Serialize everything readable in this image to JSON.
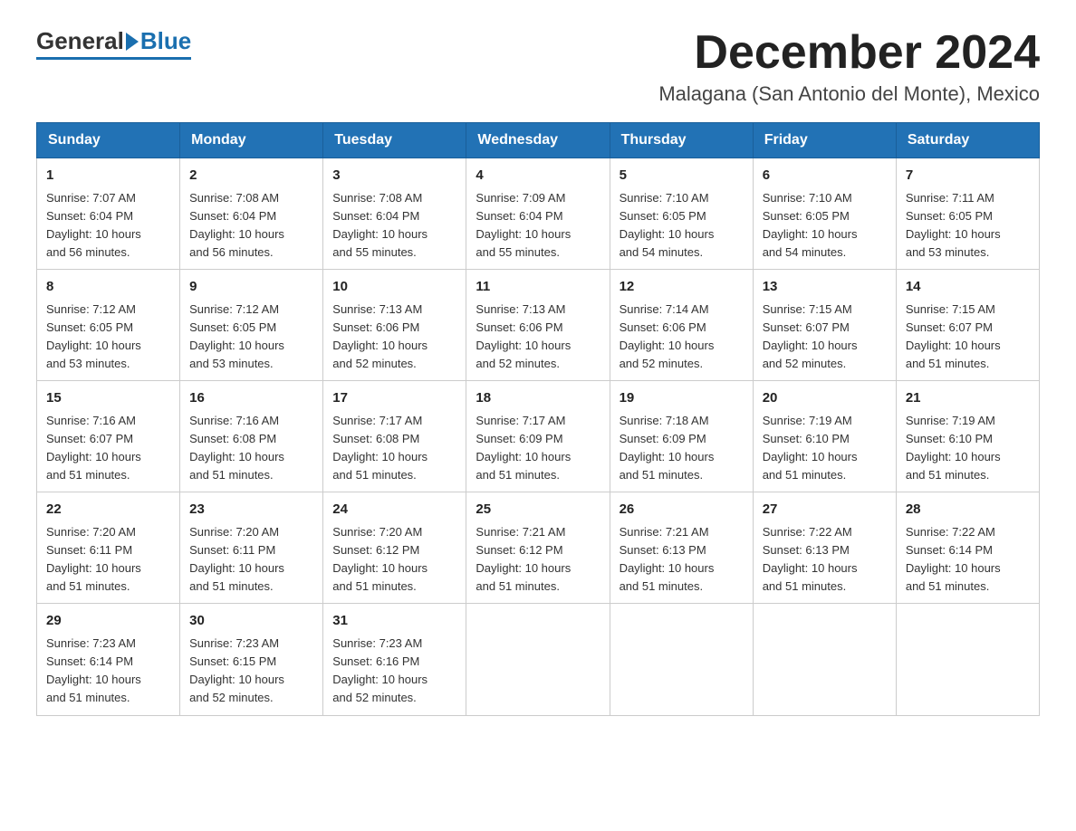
{
  "logo": {
    "general": "General",
    "blue": "Blue"
  },
  "title": "December 2024",
  "subtitle": "Malagana (San Antonio del Monte), Mexico",
  "weekdays": [
    "Sunday",
    "Monday",
    "Tuesday",
    "Wednesday",
    "Thursday",
    "Friday",
    "Saturday"
  ],
  "weeks": [
    [
      {
        "day": "1",
        "sunrise": "7:07 AM",
        "sunset": "6:04 PM",
        "daylight": "10 hours and 56 minutes."
      },
      {
        "day": "2",
        "sunrise": "7:08 AM",
        "sunset": "6:04 PM",
        "daylight": "10 hours and 56 minutes."
      },
      {
        "day": "3",
        "sunrise": "7:08 AM",
        "sunset": "6:04 PM",
        "daylight": "10 hours and 55 minutes."
      },
      {
        "day": "4",
        "sunrise": "7:09 AM",
        "sunset": "6:04 PM",
        "daylight": "10 hours and 55 minutes."
      },
      {
        "day": "5",
        "sunrise": "7:10 AM",
        "sunset": "6:05 PM",
        "daylight": "10 hours and 54 minutes."
      },
      {
        "day": "6",
        "sunrise": "7:10 AM",
        "sunset": "6:05 PM",
        "daylight": "10 hours and 54 minutes."
      },
      {
        "day": "7",
        "sunrise": "7:11 AM",
        "sunset": "6:05 PM",
        "daylight": "10 hours and 53 minutes."
      }
    ],
    [
      {
        "day": "8",
        "sunrise": "7:12 AM",
        "sunset": "6:05 PM",
        "daylight": "10 hours and 53 minutes."
      },
      {
        "day": "9",
        "sunrise": "7:12 AM",
        "sunset": "6:05 PM",
        "daylight": "10 hours and 53 minutes."
      },
      {
        "day": "10",
        "sunrise": "7:13 AM",
        "sunset": "6:06 PM",
        "daylight": "10 hours and 52 minutes."
      },
      {
        "day": "11",
        "sunrise": "7:13 AM",
        "sunset": "6:06 PM",
        "daylight": "10 hours and 52 minutes."
      },
      {
        "day": "12",
        "sunrise": "7:14 AM",
        "sunset": "6:06 PM",
        "daylight": "10 hours and 52 minutes."
      },
      {
        "day": "13",
        "sunrise": "7:15 AM",
        "sunset": "6:07 PM",
        "daylight": "10 hours and 52 minutes."
      },
      {
        "day": "14",
        "sunrise": "7:15 AM",
        "sunset": "6:07 PM",
        "daylight": "10 hours and 51 minutes."
      }
    ],
    [
      {
        "day": "15",
        "sunrise": "7:16 AM",
        "sunset": "6:07 PM",
        "daylight": "10 hours and 51 minutes."
      },
      {
        "day": "16",
        "sunrise": "7:16 AM",
        "sunset": "6:08 PM",
        "daylight": "10 hours and 51 minutes."
      },
      {
        "day": "17",
        "sunrise": "7:17 AM",
        "sunset": "6:08 PM",
        "daylight": "10 hours and 51 minutes."
      },
      {
        "day": "18",
        "sunrise": "7:17 AM",
        "sunset": "6:09 PM",
        "daylight": "10 hours and 51 minutes."
      },
      {
        "day": "19",
        "sunrise": "7:18 AM",
        "sunset": "6:09 PM",
        "daylight": "10 hours and 51 minutes."
      },
      {
        "day": "20",
        "sunrise": "7:19 AM",
        "sunset": "6:10 PM",
        "daylight": "10 hours and 51 minutes."
      },
      {
        "day": "21",
        "sunrise": "7:19 AM",
        "sunset": "6:10 PM",
        "daylight": "10 hours and 51 minutes."
      }
    ],
    [
      {
        "day": "22",
        "sunrise": "7:20 AM",
        "sunset": "6:11 PM",
        "daylight": "10 hours and 51 minutes."
      },
      {
        "day": "23",
        "sunrise": "7:20 AM",
        "sunset": "6:11 PM",
        "daylight": "10 hours and 51 minutes."
      },
      {
        "day": "24",
        "sunrise": "7:20 AM",
        "sunset": "6:12 PM",
        "daylight": "10 hours and 51 minutes."
      },
      {
        "day": "25",
        "sunrise": "7:21 AM",
        "sunset": "6:12 PM",
        "daylight": "10 hours and 51 minutes."
      },
      {
        "day": "26",
        "sunrise": "7:21 AM",
        "sunset": "6:13 PM",
        "daylight": "10 hours and 51 minutes."
      },
      {
        "day": "27",
        "sunrise": "7:22 AM",
        "sunset": "6:13 PM",
        "daylight": "10 hours and 51 minutes."
      },
      {
        "day": "28",
        "sunrise": "7:22 AM",
        "sunset": "6:14 PM",
        "daylight": "10 hours and 51 minutes."
      }
    ],
    [
      {
        "day": "29",
        "sunrise": "7:23 AM",
        "sunset": "6:14 PM",
        "daylight": "10 hours and 51 minutes."
      },
      {
        "day": "30",
        "sunrise": "7:23 AM",
        "sunset": "6:15 PM",
        "daylight": "10 hours and 52 minutes."
      },
      {
        "day": "31",
        "sunrise": "7:23 AM",
        "sunset": "6:16 PM",
        "daylight": "10 hours and 52 minutes."
      },
      null,
      null,
      null,
      null
    ]
  ],
  "labels": {
    "sunrise": "Sunrise:",
    "sunset": "Sunset:",
    "daylight": "Daylight:"
  }
}
